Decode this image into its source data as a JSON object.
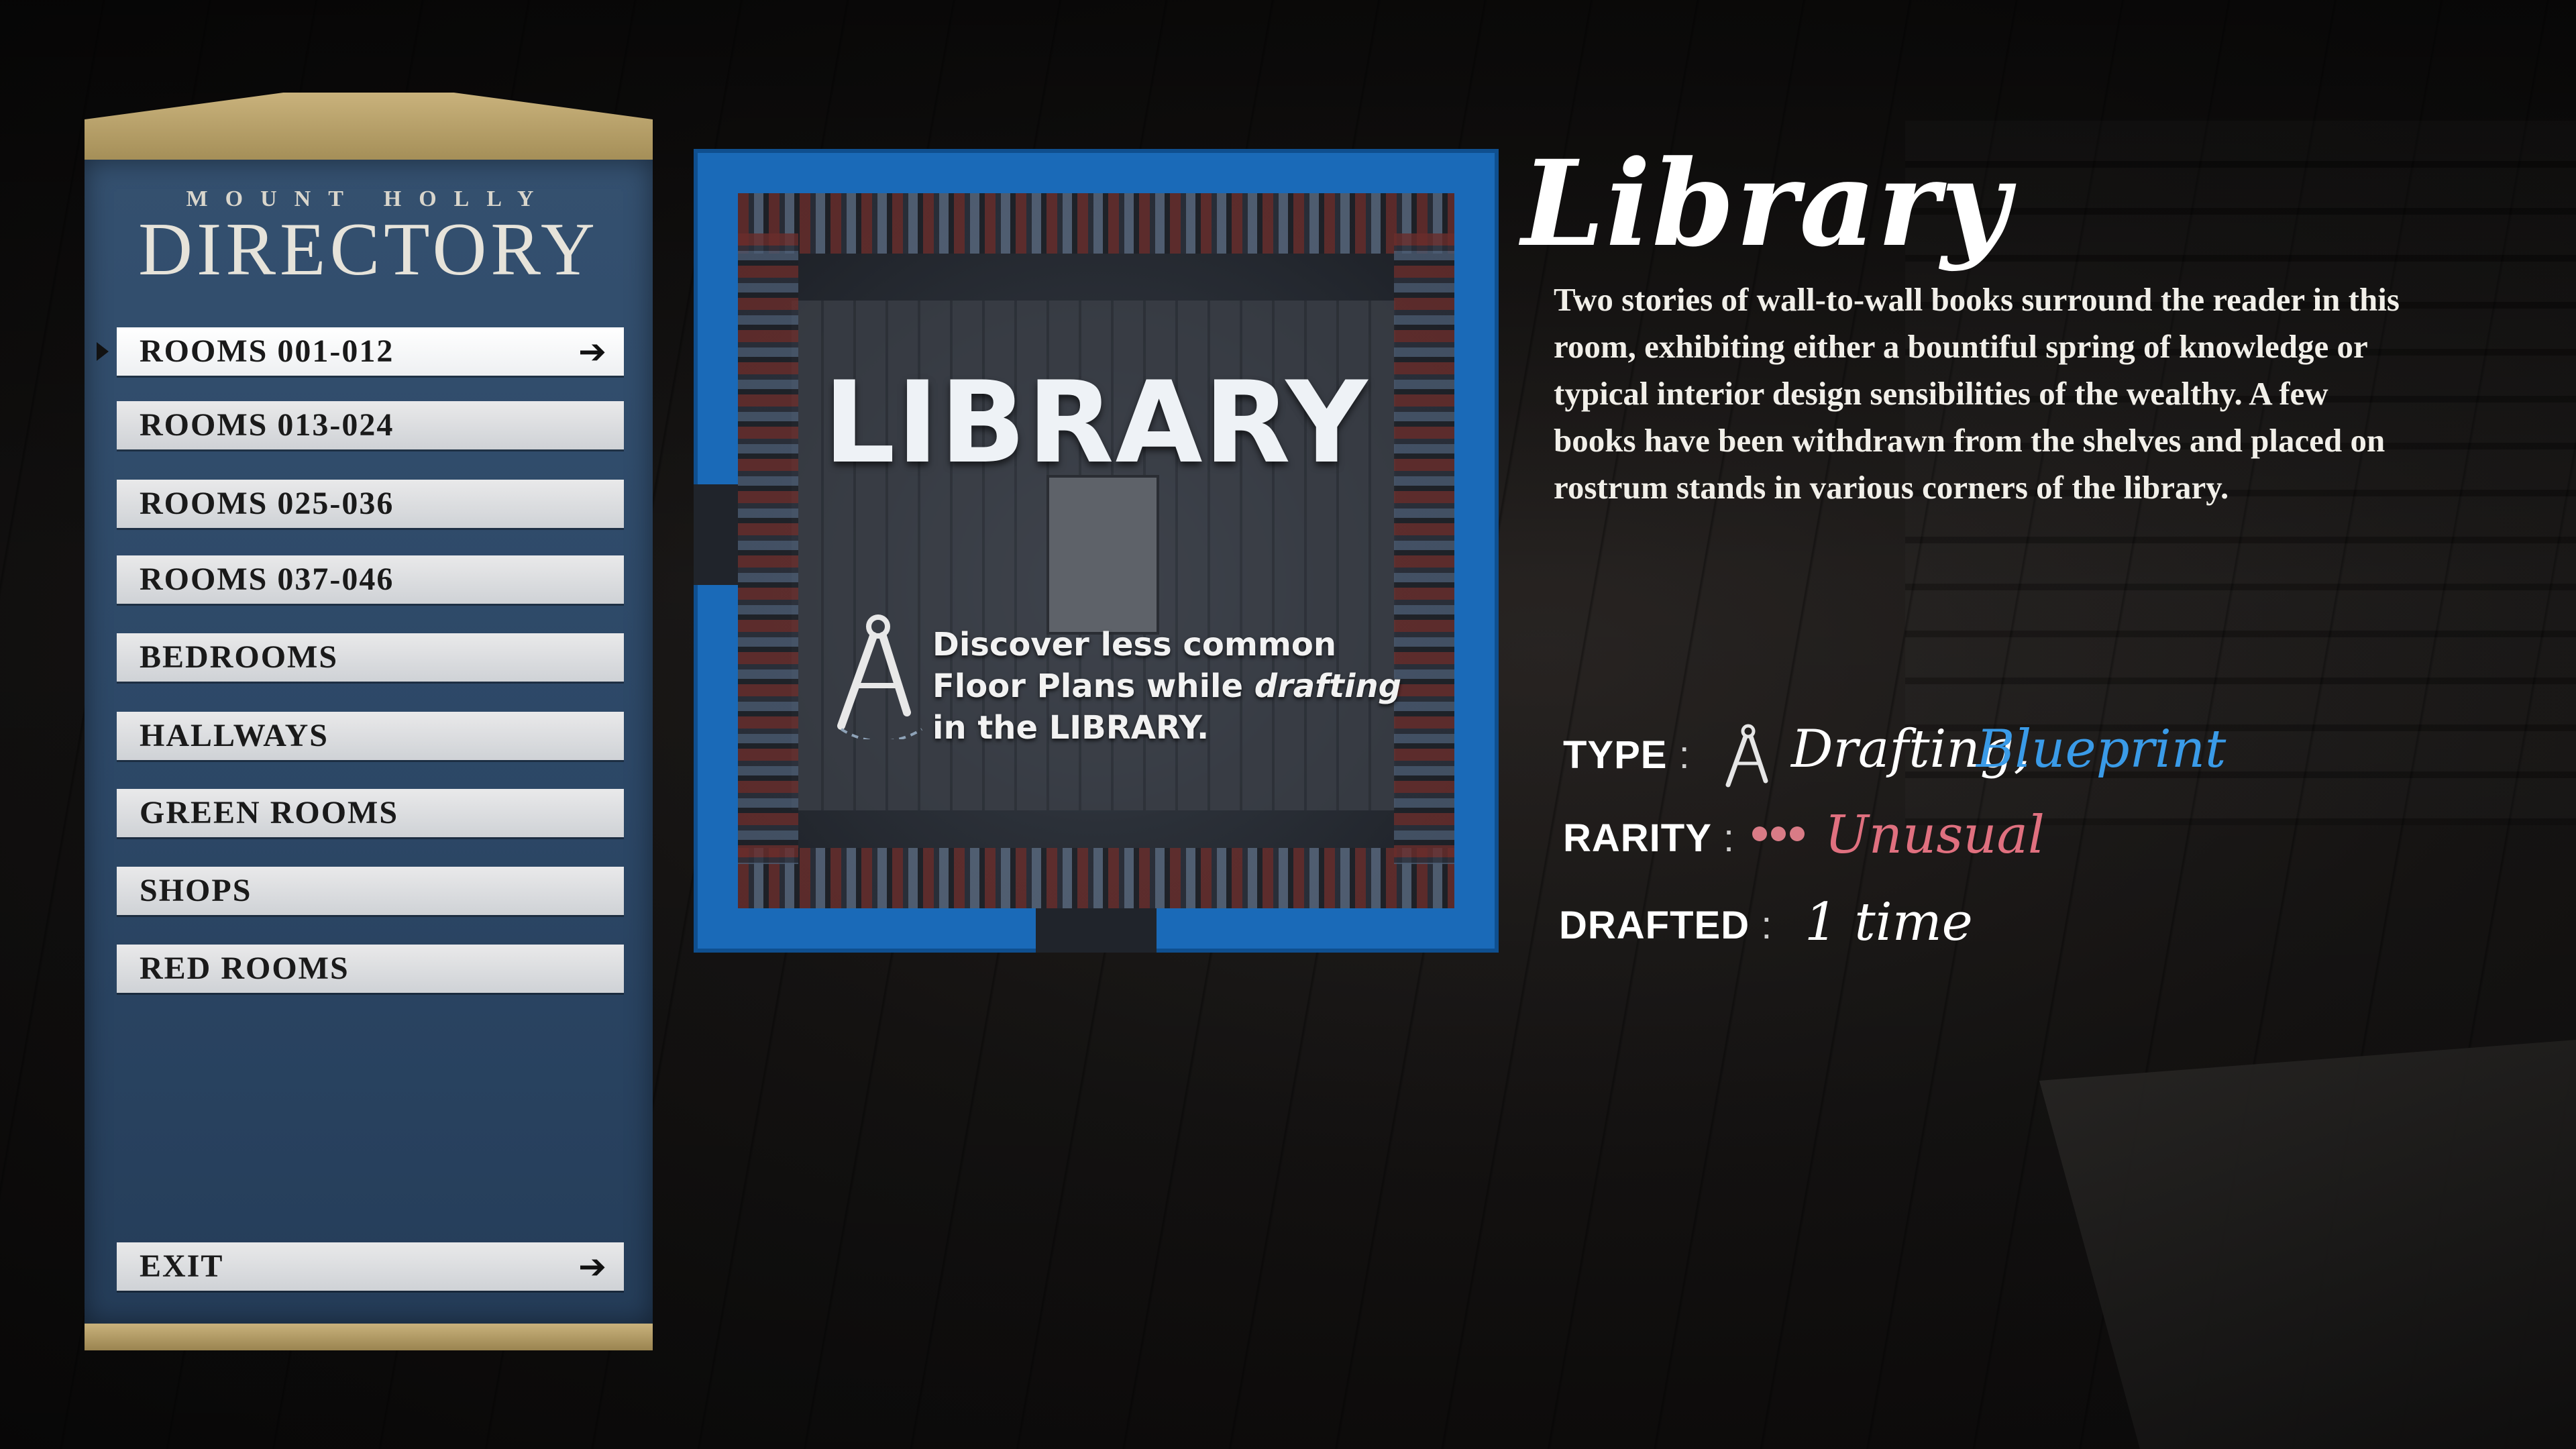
{
  "directory": {
    "subtitle": "MOUNT HOLLY",
    "title": "DIRECTORY",
    "items": [
      {
        "label": "ROOMS 001-012"
      },
      {
        "label": "ROOMS 013-024"
      },
      {
        "label": "ROOMS 025-036"
      },
      {
        "label": "ROOMS 037-046"
      },
      {
        "label": "BEDROOMS"
      },
      {
        "label": "HALLWAYS"
      },
      {
        "label": "GREEN ROOMS"
      },
      {
        "label": "SHOPS"
      },
      {
        "label": "RED ROOMS"
      }
    ],
    "selected_index": 0,
    "exit_label": "EXIT"
  },
  "card": {
    "title": "LIBRARY",
    "hint_line1": "Discover less common",
    "hint_line2_pre": "Floor Plans while ",
    "hint_line2_em": "drafting",
    "hint_line3": "in the LIBRARY."
  },
  "room": {
    "name": "Library",
    "description": "Two stories of wall-to-wall books surround the reader in this room, exhibiting either a bountiful spring of knowledge or typical interior design sensibilities of the wealthy. A few books have been withdrawn from the shelves and placed on rostrum stands in various corners of the library.",
    "type_label": "TYPE",
    "type_value_1": "Drafting,",
    "type_value_2": "Blueprint",
    "rarity_label": "RARITY",
    "rarity_value": "Unusual",
    "drafted_label": "DRAFTED",
    "drafted_value": "1 time"
  },
  "colors": {
    "panel_blue": "#2c4766",
    "card_blue": "#1a6ab8",
    "gold": "#c9b27c",
    "blueprint_blue": "#3a9be8",
    "unusual_pink": "#e0707f"
  },
  "icons": [
    "compass-icon",
    "arrow-right-icon",
    "rarity-dots-icon"
  ]
}
